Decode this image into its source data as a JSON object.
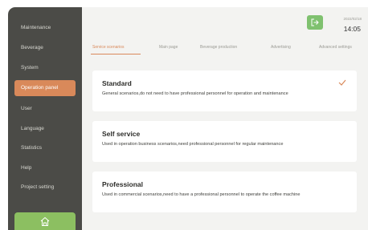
{
  "sidebar": {
    "items": [
      {
        "label": "Maintenance"
      },
      {
        "label": "Beverage"
      },
      {
        "label": "System"
      },
      {
        "label": "Operation panel"
      },
      {
        "label": "User"
      },
      {
        "label": "Language"
      },
      {
        "label": "Statistics"
      },
      {
        "label": "Help"
      },
      {
        "label": "Project setting"
      }
    ],
    "active_index": 3,
    "home_icon": "home-icon"
  },
  "header": {
    "date": "2022/02/18",
    "time": "14:05",
    "logout_icon": "logout-icon"
  },
  "tabs": [
    {
      "label": "Service scenarios"
    },
    {
      "label": "Main page"
    },
    {
      "label": "Beverage production"
    },
    {
      "label": "Advertising"
    },
    {
      "label": "Advanced settings"
    }
  ],
  "cards": [
    {
      "title": "Standard",
      "desc": "General scenarios,do not need to have professional personnel for operation and maintenance",
      "selected": true
    },
    {
      "title": "Self service",
      "desc": "Used in operation business scenarios,need professional personnel for regular maintenance",
      "selected": false
    },
    {
      "title": "Professional",
      "desc": "Used in commercial scenarios,need to have a professional personnel to operate the coffee machine",
      "selected": false
    }
  ],
  "colors": {
    "accent": "#d9895a",
    "sidebar_bg": "#4b4b47",
    "home_button": "#8cbf61",
    "logout_button": "#7fc16f",
    "background": "#f3f3f1"
  }
}
